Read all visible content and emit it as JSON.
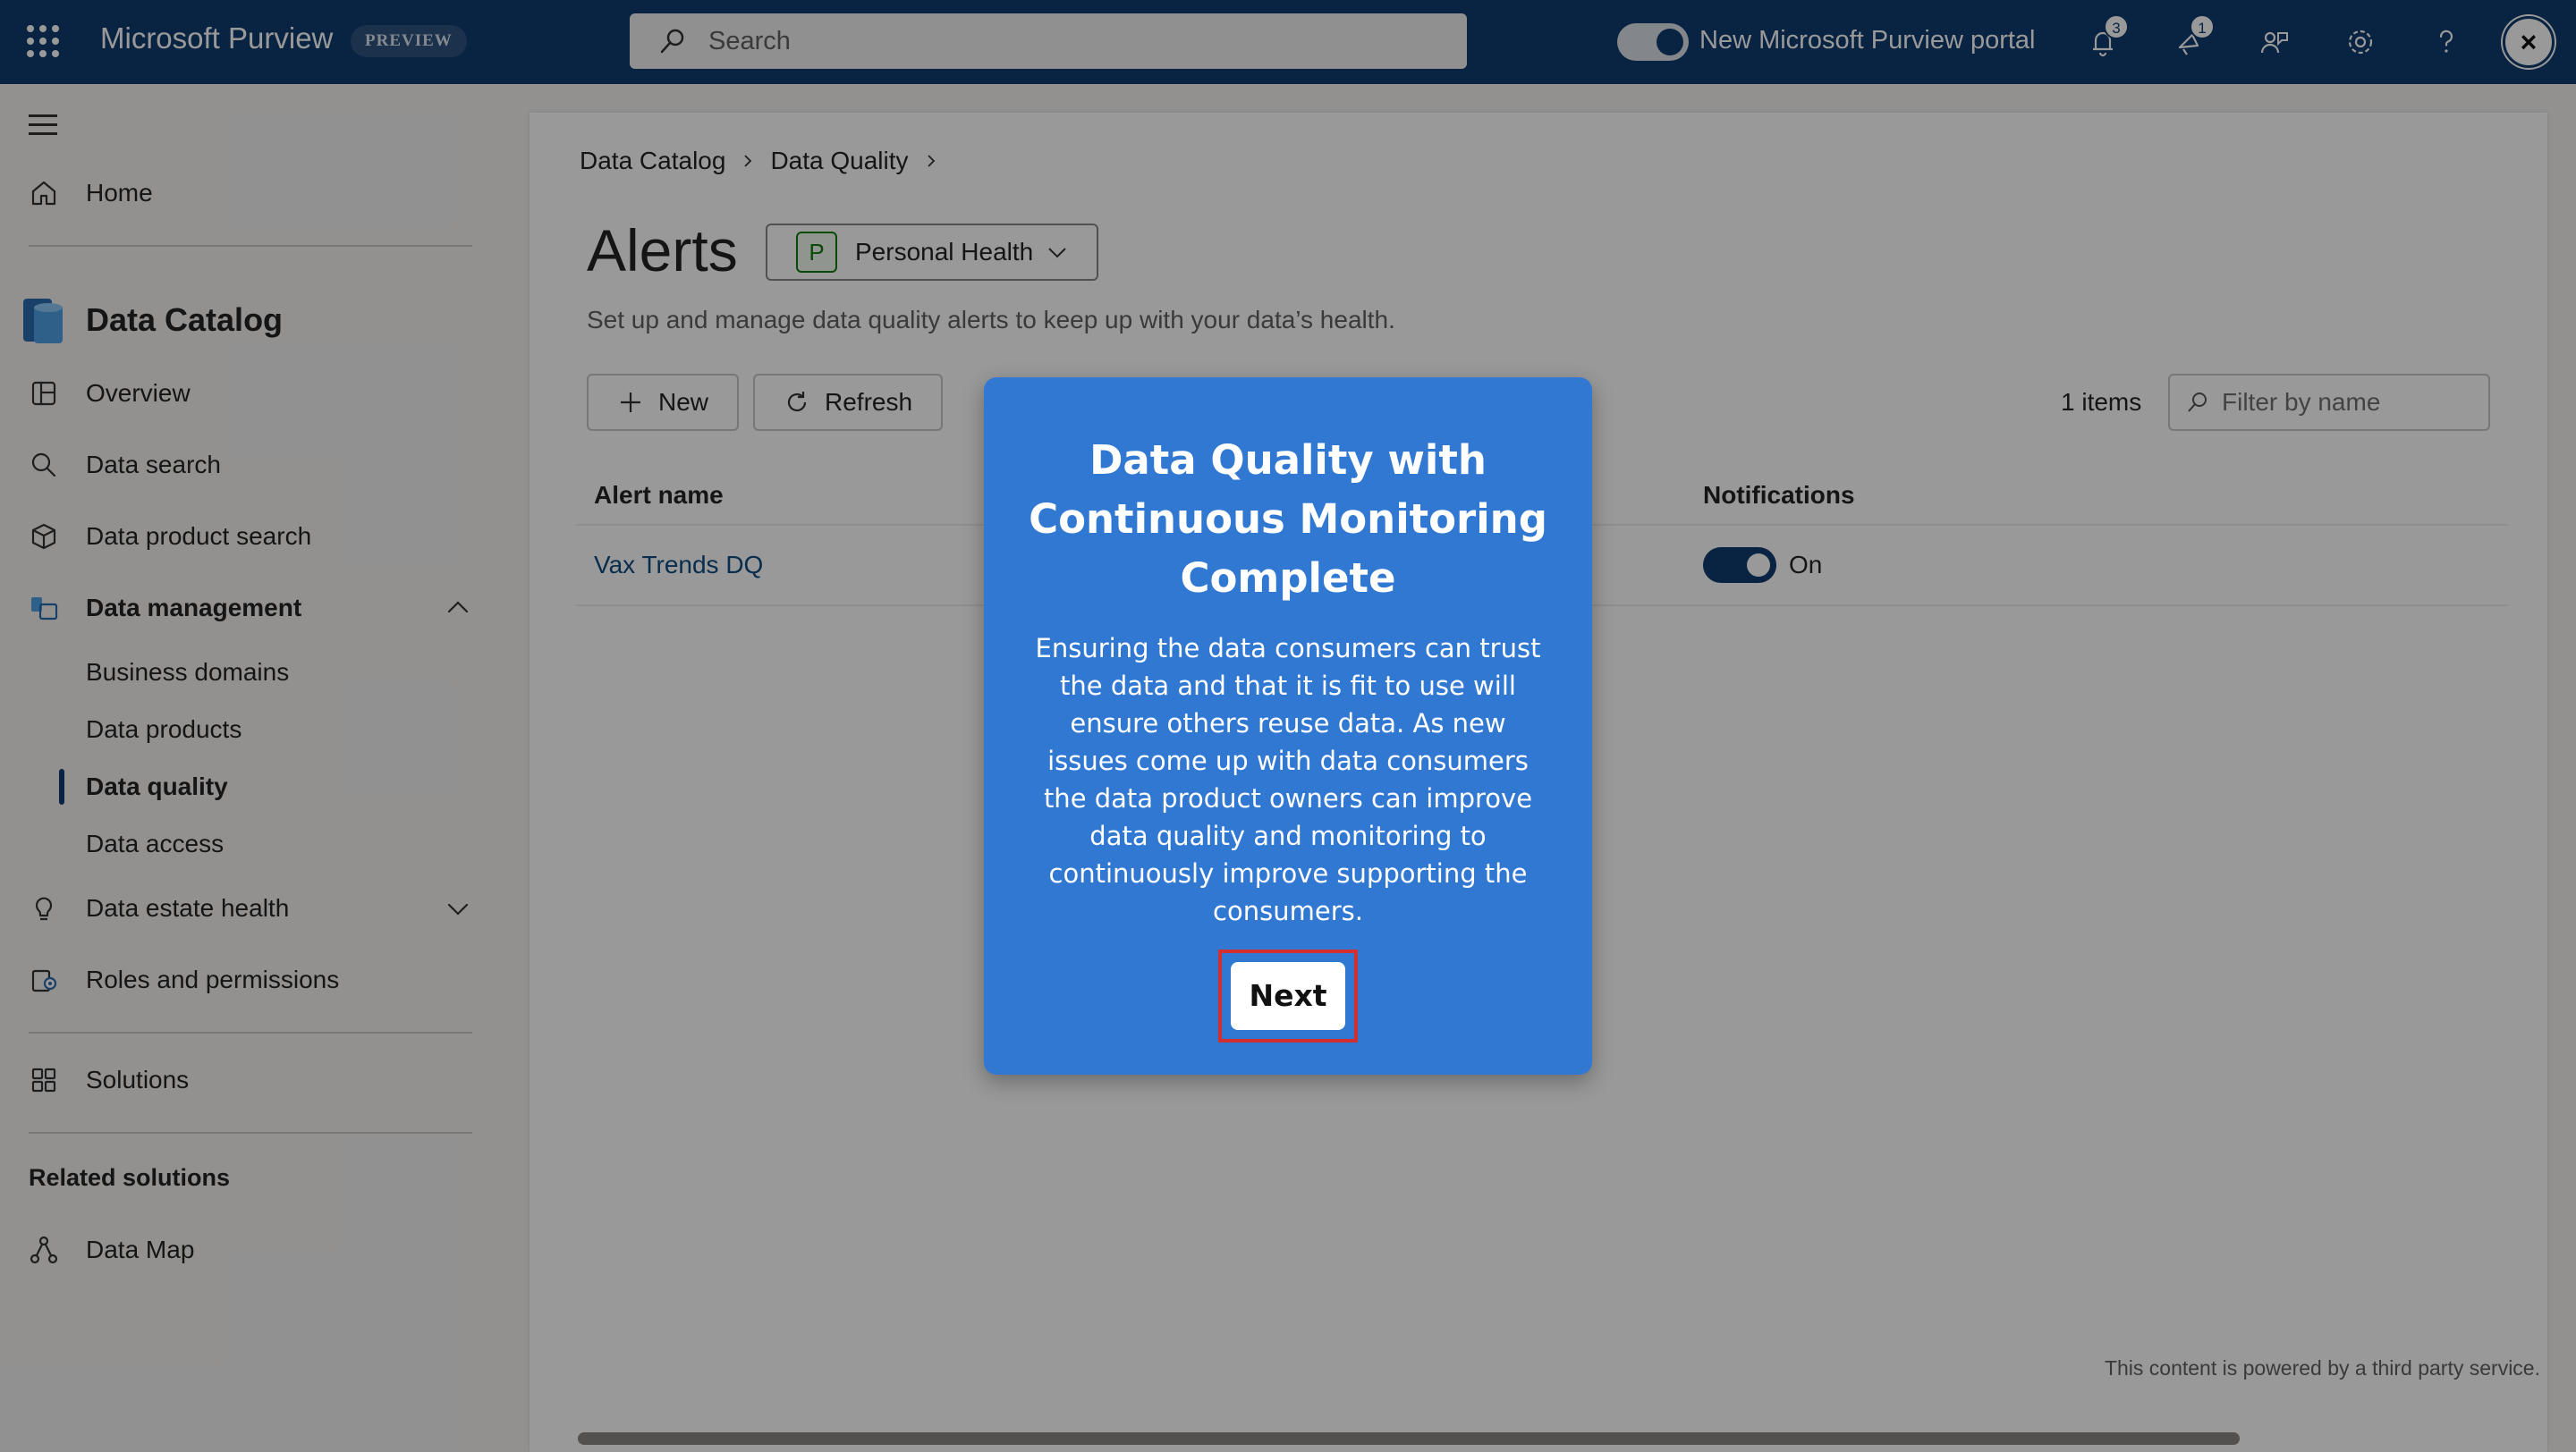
{
  "topbar": {
    "app_title": "Microsoft Purview",
    "preview_badge": "PREVIEW",
    "search_placeholder": "Search",
    "portal_toggle_label": "New Microsoft Purview portal",
    "notifications_count": "3",
    "alerts_count": "1",
    "avatar_glyph": "×",
    "colors": {
      "bar": "#0f3b6e"
    }
  },
  "sidebar": {
    "home": "Home",
    "section_title": "Data Catalog",
    "items": [
      "Overview",
      "Data search",
      "Data product search"
    ],
    "data_management": "Data management",
    "sub_items": [
      "Business domains",
      "Data products",
      "Data quality",
      "Data access"
    ],
    "active_item": "Data quality",
    "data_estate_health": "Data estate health",
    "roles": "Roles and permissions",
    "solutions": "Solutions",
    "related_title": "Related solutions",
    "data_map": "Data Map"
  },
  "main": {
    "breadcrumb": [
      "Data Catalog",
      "Data Quality"
    ],
    "title": "Alerts",
    "domain_initial": "P",
    "domain_name": "Personal Health",
    "subtitle": "Set up and manage data quality alerts to keep up with your data’s health.",
    "new_label": "New",
    "refresh_label": "Refresh",
    "items_count": "1 items",
    "filter_placeholder": "Filter by name",
    "columns": [
      "Alert name",
      "Notifications"
    ],
    "rows": [
      {
        "name": "Vax Trends DQ",
        "notifications_state": "On",
        "notifications_on": true
      }
    ],
    "powered_by": "This content is powered by a third party service."
  },
  "popup": {
    "title": "Data Quality with Continuous Monitoring Complete",
    "body": "Ensuring the data consumers can trust the data and that it is fit to use will ensure others reuse data. As new issues come up with data consumers the data product owners can improve data quality and monitoring to continuously improve supporting the consumers.",
    "next_label": "Next",
    "colors": {
      "background": "#3178d3",
      "highlight": "#d32f2f"
    }
  }
}
